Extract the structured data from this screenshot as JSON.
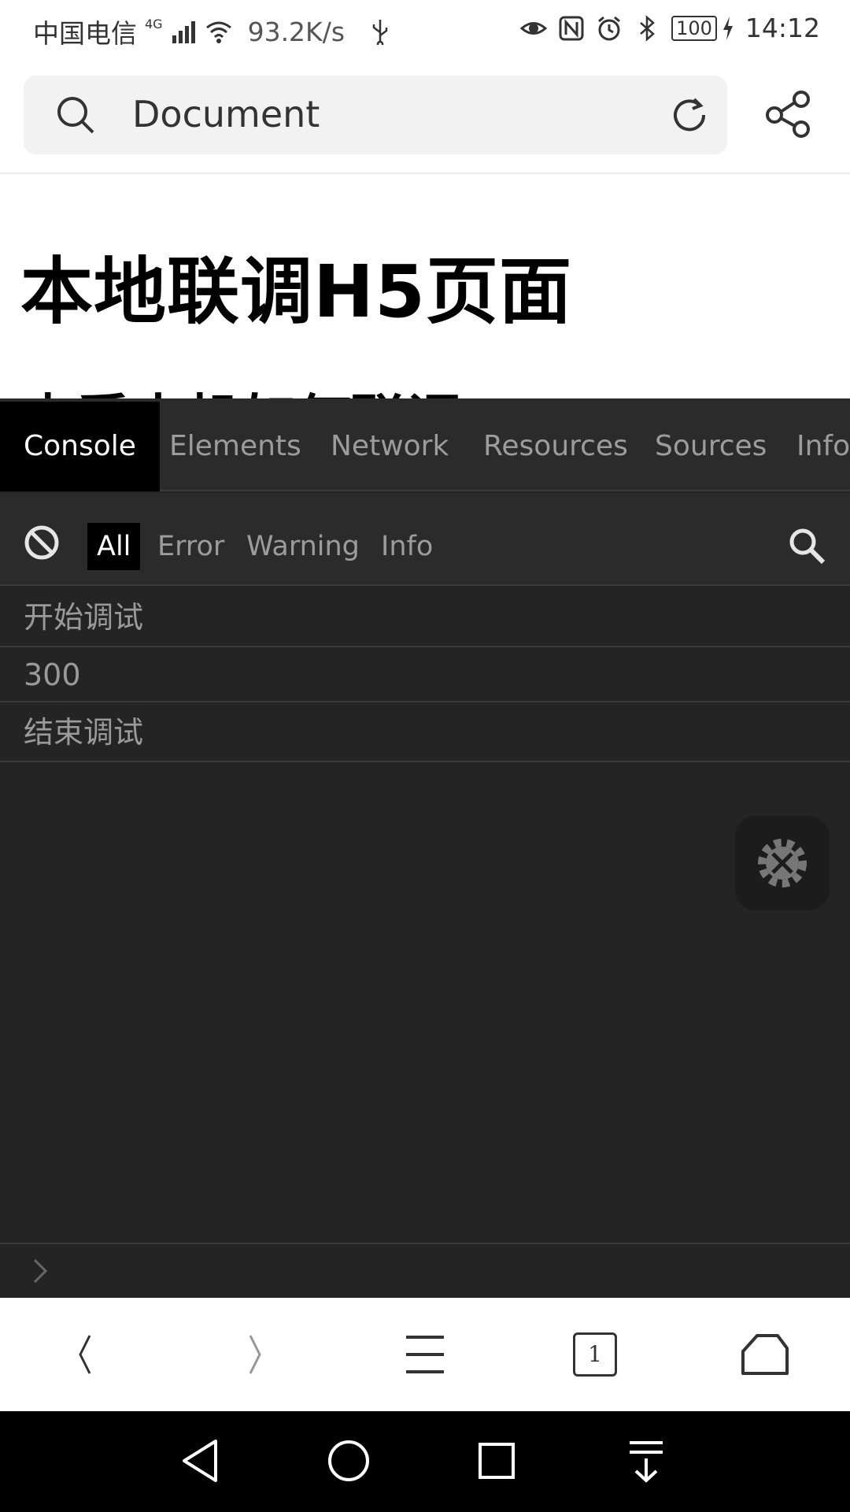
{
  "status_bar": {
    "carrier": "中国电信",
    "network": "4G",
    "speed": "93.2K/s",
    "battery": "100",
    "time": "14:12"
  },
  "address_bar": {
    "title": "Document"
  },
  "page": {
    "heading": "本地联调H5页面",
    "subheading": "查看本机如何联调"
  },
  "devtools": {
    "tabs": [
      {
        "label": "Console",
        "active": true
      },
      {
        "label": "Elements",
        "active": false
      },
      {
        "label": "Network",
        "active": false
      },
      {
        "label": "Resources",
        "active": false
      },
      {
        "label": "Sources",
        "active": false
      },
      {
        "label": "Info",
        "active": false
      }
    ],
    "filters": [
      {
        "label": "All",
        "active": true
      },
      {
        "label": "Error",
        "active": false
      },
      {
        "label": "Warning",
        "active": false
      },
      {
        "label": "Info",
        "active": false
      }
    ],
    "logs": [
      "开始调试",
      "300",
      "结束调试"
    ]
  },
  "browser_toolbar": {
    "tab_count": "1"
  },
  "icons": {
    "status": [
      "signal-icon",
      "wifi-icon",
      "usb-icon",
      "eye-icon",
      "nfc-icon",
      "alarm-icon",
      "bluetooth-icon",
      "battery-icon",
      "charging-icon"
    ],
    "toolbar": [
      "back-icon",
      "forward-icon",
      "menu-icon",
      "tabs-icon",
      "home-icon"
    ],
    "nav": [
      "nav-back-icon",
      "nav-home-icon",
      "nav-recents-icon",
      "nav-notification-icon"
    ]
  },
  "colors": {
    "devtools_bg": "#242424",
    "tab_bar_bg": "#2b2b2b",
    "active_tab_bg": "#000000",
    "text_muted": "#9c9c9c"
  }
}
